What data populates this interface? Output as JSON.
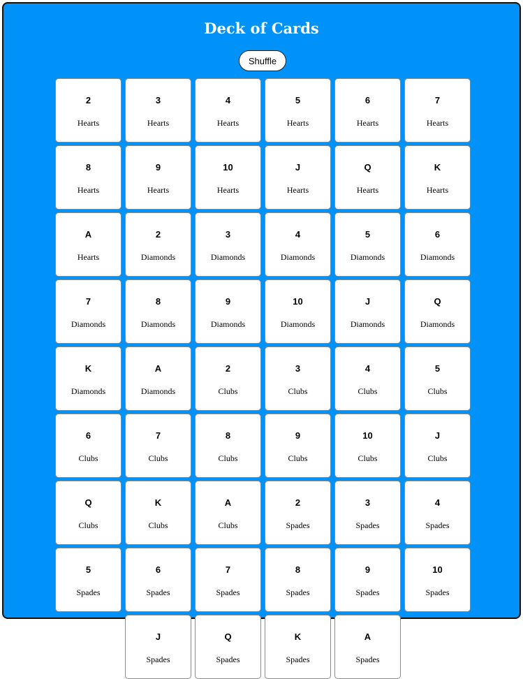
{
  "app": {
    "title": "Deck of Cards",
    "shuffle_label": "Shuffle"
  },
  "cards": [
    {
      "rank": "2",
      "suit": "Hearts"
    },
    {
      "rank": "3",
      "suit": "Hearts"
    },
    {
      "rank": "4",
      "suit": "Hearts"
    },
    {
      "rank": "5",
      "suit": "Hearts"
    },
    {
      "rank": "6",
      "suit": "Hearts"
    },
    {
      "rank": "7",
      "suit": "Hearts"
    },
    {
      "rank": "8",
      "suit": "Hearts"
    },
    {
      "rank": "9",
      "suit": "Hearts"
    },
    {
      "rank": "10",
      "suit": "Hearts"
    },
    {
      "rank": "J",
      "suit": "Hearts"
    },
    {
      "rank": "Q",
      "suit": "Hearts"
    },
    {
      "rank": "K",
      "suit": "Hearts"
    },
    {
      "rank": "A",
      "suit": "Hearts"
    },
    {
      "rank": "2",
      "suit": "Diamonds"
    },
    {
      "rank": "3",
      "suit": "Diamonds"
    },
    {
      "rank": "4",
      "suit": "Diamonds"
    },
    {
      "rank": "5",
      "suit": "Diamonds"
    },
    {
      "rank": "6",
      "suit": "Diamonds"
    },
    {
      "rank": "7",
      "suit": "Diamonds"
    },
    {
      "rank": "8",
      "suit": "Diamonds"
    },
    {
      "rank": "9",
      "suit": "Diamonds"
    },
    {
      "rank": "10",
      "suit": "Diamonds"
    },
    {
      "rank": "J",
      "suit": "Diamonds"
    },
    {
      "rank": "Q",
      "suit": "Diamonds"
    },
    {
      "rank": "K",
      "suit": "Diamonds"
    },
    {
      "rank": "A",
      "suit": "Diamonds"
    },
    {
      "rank": "2",
      "suit": "Clubs"
    },
    {
      "rank": "3",
      "suit": "Clubs"
    },
    {
      "rank": "4",
      "suit": "Clubs"
    },
    {
      "rank": "5",
      "suit": "Clubs"
    },
    {
      "rank": "6",
      "suit": "Clubs"
    },
    {
      "rank": "7",
      "suit": "Clubs"
    },
    {
      "rank": "8",
      "suit": "Clubs"
    },
    {
      "rank": "9",
      "suit": "Clubs"
    },
    {
      "rank": "10",
      "suit": "Clubs"
    },
    {
      "rank": "J",
      "suit": "Clubs"
    },
    {
      "rank": "Q",
      "suit": "Clubs"
    },
    {
      "rank": "K",
      "suit": "Clubs"
    },
    {
      "rank": "A",
      "suit": "Clubs"
    },
    {
      "rank": "2",
      "suit": "Spades"
    },
    {
      "rank": "3",
      "suit": "Spades"
    },
    {
      "rank": "4",
      "suit": "Spades"
    },
    {
      "rank": "5",
      "suit": "Spades"
    },
    {
      "rank": "6",
      "suit": "Spades"
    },
    {
      "rank": "7",
      "suit": "Spades"
    },
    {
      "rank": "8",
      "suit": "Spades"
    },
    {
      "rank": "9",
      "suit": "Spades"
    },
    {
      "rank": "10",
      "suit": "Spades"
    },
    {
      "rank": "J",
      "suit": "Spades"
    },
    {
      "rank": "Q",
      "suit": "Spades"
    },
    {
      "rank": "K",
      "suit": "Spades"
    },
    {
      "rank": "A",
      "suit": "Spades"
    }
  ],
  "colors": {
    "panel_background": "#0092f8",
    "card_background": "#ffffff",
    "title_text": "#ffffff"
  }
}
